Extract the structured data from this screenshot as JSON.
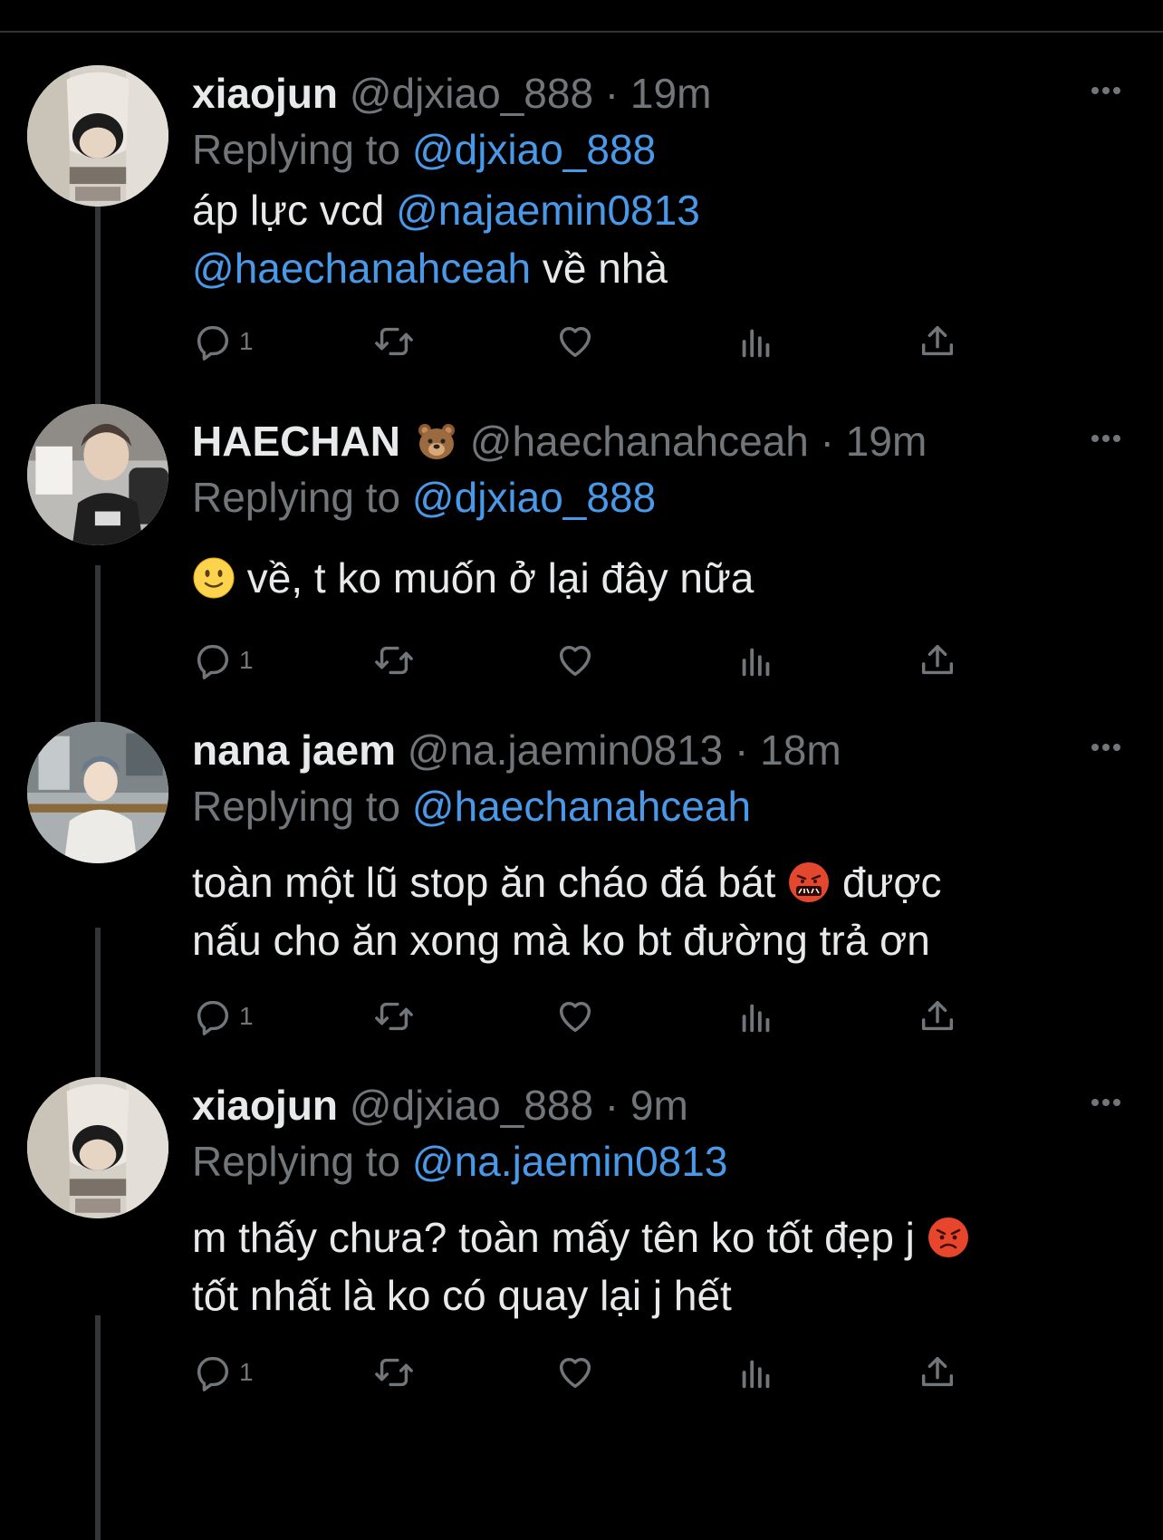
{
  "tweets": [
    {
      "name": "xiaojun",
      "name_emoji": "",
      "handle": "@djxiao_888",
      "time": "19m",
      "replying_prefix": "Replying to",
      "replying_to": "@djxiao_888",
      "lines": [
        [
          {
            "t": "text",
            "v": "áp lực vcd "
          },
          {
            "t": "mention",
            "v": "@najaemin0813"
          }
        ],
        [
          {
            "t": "mention",
            "v": "@haechanahceah"
          },
          {
            "t": "text",
            "v": " về nhà"
          }
        ]
      ],
      "reply_count": "1",
      "avatar": "xiaojun-avatar"
    },
    {
      "name": "HAECHAN",
      "name_emoji": "bear-face-emoji",
      "handle": "@haechanahceah",
      "time": "19m",
      "replying_prefix": "Replying to",
      "replying_to": "@djxiao_888",
      "lines": [
        [
          {
            "t": "emoji",
            "v": "slightly-smiling-face-emoji"
          },
          {
            "t": "text",
            "v": " về, t ko muốn ở lại đây nữa"
          }
        ]
      ],
      "reply_count": "1",
      "avatar": "haechan-avatar"
    },
    {
      "name": "nana jaem",
      "name_emoji": "",
      "handle": "@na.jaemin0813",
      "time": "18m",
      "replying_prefix": "Replying to",
      "replying_to": "@haechanahceah",
      "lines": [
        [
          {
            "t": "text",
            "v": "toàn một lũ stop ăn cháo đá bát "
          },
          {
            "t": "emoji",
            "v": "face-with-symbols-emoji"
          },
          {
            "t": "text",
            "v": " được"
          }
        ],
        [
          {
            "t": "text",
            "v": "nấu cho ăn xong mà ko bt đường trả ơn"
          }
        ]
      ],
      "reply_count": "1",
      "avatar": "jaemin-avatar"
    },
    {
      "name": "xiaojun",
      "name_emoji": "",
      "handle": "@djxiao_888",
      "time": "9m",
      "replying_prefix": "Replying to",
      "replying_to": "@na.jaemin0813",
      "lines": [
        [
          {
            "t": "text",
            "v": "m thấy chưa? toàn mấy tên ko tốt đẹp j "
          },
          {
            "t": "emoji",
            "v": "pouting-face-emoji"
          }
        ],
        [
          {
            "t": "text",
            "v": "tốt nhất là ko có quay lại j hết"
          }
        ]
      ],
      "reply_count": "1",
      "avatar": "xiaojun-avatar"
    }
  ],
  "icons": {
    "reply": "reply-icon",
    "retweet": "retweet-icon",
    "like": "like-icon",
    "views": "views-icon",
    "share": "share-icon",
    "more": "more-icon"
  },
  "colors": {
    "background": "#000000",
    "text": "#e7e9ea",
    "muted": "#71767b",
    "link": "#4a99e9",
    "thread_line": "#333639"
  }
}
